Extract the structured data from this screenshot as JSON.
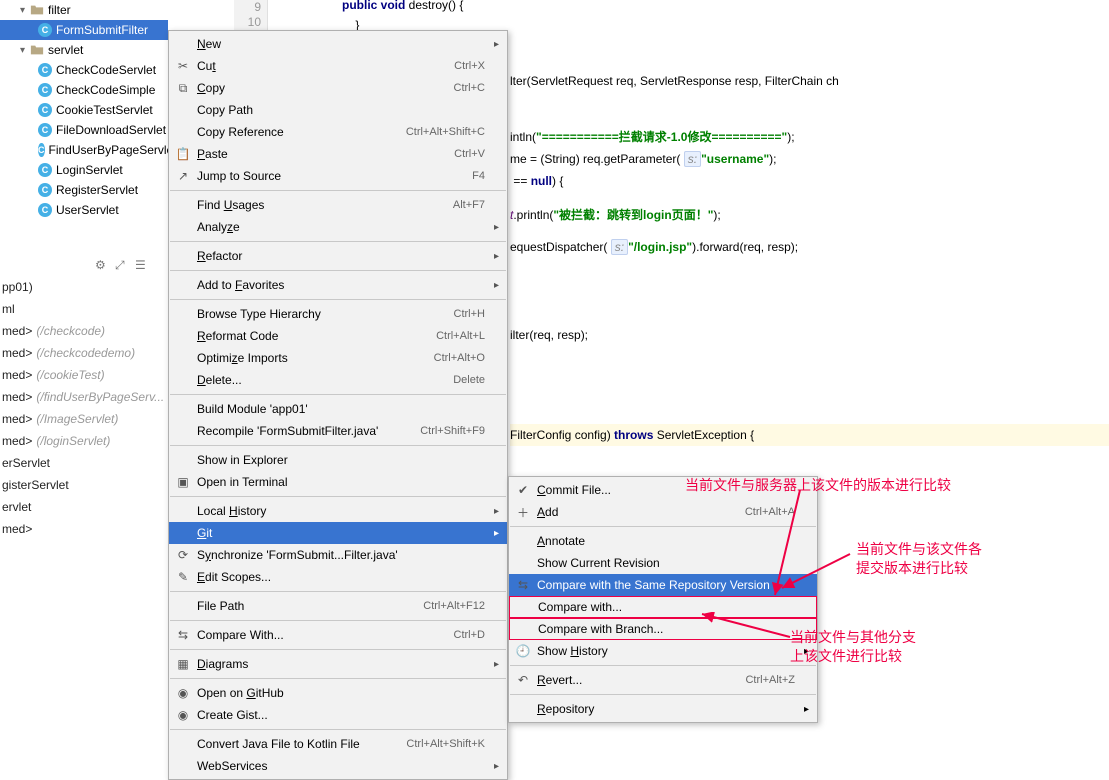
{
  "tree": {
    "folder1": "filter",
    "selected_class": "FormSubmitFilter",
    "folder2": "servlet",
    "classes": [
      "CheckCodeServlet",
      "CheckCodeSimple",
      "CookieTestServlet",
      "FileDownloadServlet",
      "FindUserByPageServlet",
      "LoginServlet",
      "RegisterServlet",
      "UserServlet"
    ]
  },
  "structure": [
    {
      "n": "pp01)",
      "p": ""
    },
    {
      "n": "ml",
      "p": ""
    },
    {
      "n": "med>",
      "p": "(/checkcode)"
    },
    {
      "n": "med>",
      "p": "(/checkcodedemo)"
    },
    {
      "n": "med>",
      "p": "(/cookieTest)"
    },
    {
      "n": "med>",
      "p": "(/findUserByPageServ..."
    },
    {
      "n": "med>",
      "p": "(/ImageServlet)"
    },
    {
      "n": "med>",
      "p": "(/loginServlet)"
    },
    {
      "n": "erServlet",
      "p": ""
    },
    {
      "n": "gisterServlet",
      "p": ""
    },
    {
      "n": "ervlet",
      "p": ""
    },
    {
      "n": "med>",
      "p": ""
    }
  ],
  "gutter": [
    "9",
    "10"
  ],
  "code": {
    "l0a": "public void",
    "l0b": " destroy() {",
    "l1": "    }",
    "l3": "lter(ServletRequest req, ServletResponse resp, FilterChain ch",
    "l5a": "intln(",
    "l5b": "\"===========拦截请求-1.0修改==========\"",
    "l5c": ");",
    "l6a": "me = (String) req.getParameter( ",
    "l6p": "s:",
    "l6q": "\"username\"",
    "l6b": ");",
    "l7a": " == ",
    "l7b": "null",
    "l7c": ") {",
    "l8a": "t",
    "l8b": ".println(",
    "l8c": "\"被拦截：跳转到login页面！\"",
    "l8d": ");",
    "l9a": "equestDispatcher( ",
    "l9p": "s:",
    "l9q": "\"/login.jsp\"",
    "l9b": ").forward(req, resp);",
    "l13": "ilter(req, resp);",
    "l18a": "FilterConfig config) ",
    "l18b": "throws",
    "l18c": " ServletException {"
  },
  "menu": [
    {
      "t": "item",
      "label": "New",
      "arrow": true,
      "u": "N"
    },
    {
      "t": "item",
      "label": "Cut",
      "sc": "Ctrl+X",
      "icon": "cut",
      "u": "t"
    },
    {
      "t": "item",
      "label": "Copy",
      "sc": "Ctrl+C",
      "icon": "copy",
      "u": "C"
    },
    {
      "t": "item",
      "label": "Copy Path"
    },
    {
      "t": "item",
      "label": "Copy Reference",
      "sc": "Ctrl+Alt+Shift+C"
    },
    {
      "t": "item",
      "label": "Paste",
      "sc": "Ctrl+V",
      "icon": "paste",
      "u": "P"
    },
    {
      "t": "item",
      "label": "Jump to Source",
      "sc": "F4",
      "icon": "jump"
    },
    {
      "t": "sep"
    },
    {
      "t": "item",
      "label": "Find Usages",
      "sc": "Alt+F7",
      "u": "U"
    },
    {
      "t": "item",
      "label": "Analyze",
      "arrow": true,
      "u": "z"
    },
    {
      "t": "sep"
    },
    {
      "t": "item",
      "label": "Refactor",
      "arrow": true,
      "u": "R"
    },
    {
      "t": "sep"
    },
    {
      "t": "item",
      "label": "Add to Favorites",
      "arrow": true,
      "u": "F"
    },
    {
      "t": "sep"
    },
    {
      "t": "item",
      "label": "Browse Type Hierarchy",
      "sc": "Ctrl+H"
    },
    {
      "t": "item",
      "label": "Reformat Code",
      "sc": "Ctrl+Alt+L",
      "u": "R"
    },
    {
      "t": "item",
      "label": "Optimize Imports",
      "sc": "Ctrl+Alt+O",
      "u": "z"
    },
    {
      "t": "item",
      "label": "Delete...",
      "sc": "Delete",
      "u": "D"
    },
    {
      "t": "sep"
    },
    {
      "t": "item",
      "label": "Build Module 'app01'"
    },
    {
      "t": "item",
      "label": "Recompile 'FormSubmitFilter.java'",
      "sc": "Ctrl+Shift+F9"
    },
    {
      "t": "sep"
    },
    {
      "t": "item",
      "label": "Show in Explorer"
    },
    {
      "t": "item",
      "label": "Open in Terminal",
      "icon": "terminal"
    },
    {
      "t": "sep"
    },
    {
      "t": "item",
      "label": "Local History",
      "arrow": true,
      "u": "H"
    },
    {
      "t": "item",
      "label": "Git",
      "arrow": true,
      "hl": true,
      "u": "G"
    },
    {
      "t": "item",
      "label": "Synchronize 'FormSubmit...Filter.java'",
      "icon": "sync",
      "u": "y"
    },
    {
      "t": "item",
      "label": "Edit Scopes...",
      "icon": "edit",
      "u": "E"
    },
    {
      "t": "sep"
    },
    {
      "t": "item",
      "label": "File Path",
      "sc": "Ctrl+Alt+F12"
    },
    {
      "t": "sep"
    },
    {
      "t": "item",
      "label": "Compare With...",
      "sc": "Ctrl+D",
      "icon": "compare"
    },
    {
      "t": "sep"
    },
    {
      "t": "item",
      "label": "Diagrams",
      "arrow": true,
      "icon": "diagram",
      "u": "D"
    },
    {
      "t": "sep"
    },
    {
      "t": "item",
      "label": "Open on GitHub",
      "icon": "github",
      "u": "G"
    },
    {
      "t": "item",
      "label": "Create Gist...",
      "icon": "github"
    },
    {
      "t": "sep"
    },
    {
      "t": "item",
      "label": "Convert Java File to Kotlin File",
      "sc": "Ctrl+Alt+Shift+K"
    },
    {
      "t": "item",
      "label": "WebServices",
      "arrow": true
    }
  ],
  "submenu": [
    {
      "label": "Commit File...",
      "u": "C",
      "icon": "commit"
    },
    {
      "label": "Add",
      "sc": "Ctrl+Alt+A",
      "u": "A",
      "icon": "add"
    },
    {
      "sep": true
    },
    {
      "label": "Annotate",
      "u": "A"
    },
    {
      "label": "Show Current Revision"
    },
    {
      "label": "Compare with the Same Repository Version",
      "hl": true,
      "icon": "compare"
    },
    {
      "label": "Compare with...",
      "red": true
    },
    {
      "label": "Compare with Branch...",
      "red": true
    },
    {
      "label": "Show History",
      "arrow": true,
      "u": "H",
      "icon": "history"
    },
    {
      "sep": true
    },
    {
      "label": "Revert...",
      "sc": "Ctrl+Alt+Z",
      "u": "R",
      "icon": "revert"
    },
    {
      "sep": true
    },
    {
      "label": "Repository",
      "arrow": true,
      "u": "R"
    }
  ],
  "annotations": {
    "a1": "当前文件与服务器上该文件的版本进行比较",
    "a2a": "当前文件与该文件各",
    "a2b": "提交版本进行比较",
    "a3a": "当前文件与其他分支",
    "a3b": "上该文件进行比较"
  }
}
